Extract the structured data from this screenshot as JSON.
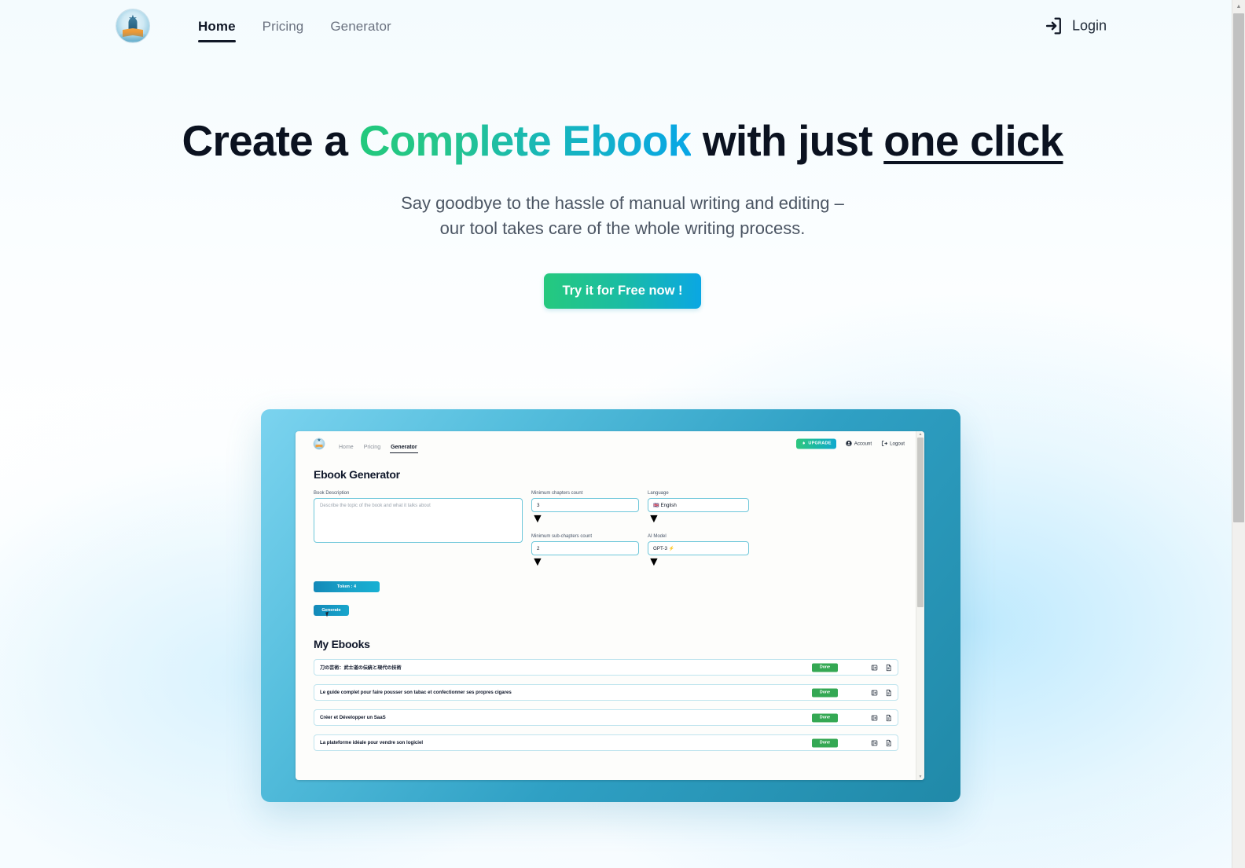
{
  "nav": {
    "logo_icon": "ebook-star-logo",
    "links": [
      {
        "label": "Home",
        "active": true
      },
      {
        "label": "Pricing",
        "active": false
      },
      {
        "label": "Generator",
        "active": false
      }
    ],
    "login": {
      "label": "Login",
      "icon": "sign-in-icon"
    }
  },
  "hero": {
    "headline_part1": "Create a ",
    "headline_highlight": "Complete Ebook",
    "headline_part2": " with just ",
    "headline_underlined": "one click",
    "subtitle_line1": "Say goodbye to the hassle of manual writing and editing –",
    "subtitle_line2": "our tool takes care of the whole writing process.",
    "cta_label": "Try it for Free now !"
  },
  "colors": {
    "gradient_start": "#22c97c",
    "gradient_end": "#08a6e6",
    "frame_light": "#7bd3ef",
    "frame_dark": "#2089a8",
    "status_done": "#34a853",
    "token_blue": "#1389b8"
  },
  "showcase": {
    "app_header": {
      "logo_icon": "ebook-star-logo",
      "links": [
        {
          "label": "Home",
          "active": false
        },
        {
          "label": "Pricing",
          "active": false
        },
        {
          "label": "Generator",
          "active": true
        }
      ],
      "upgrade_label": "UPGRADE",
      "upgrade_icon": "rocket-icon",
      "account_label": "Account",
      "account_icon": "user-circle-icon",
      "logout_label": "Logout",
      "logout_icon": "sign-out-icon"
    },
    "generator": {
      "title": "Ebook Generator",
      "book_description_label": "Book Description",
      "book_description_placeholder": "Describe the topic of the book and what it talks about",
      "book_description_value": "",
      "min_chapters_label": "Minimum chapters count",
      "min_chapters_value": "3",
      "min_subchapters_label": "Minimum sub-chapters count",
      "min_subchapters_value": "2",
      "language_label": "Language",
      "language_value": "English",
      "language_flag": "🇬🇧",
      "ai_model_label": "AI Model",
      "ai_model_value": "GPT-3",
      "ai_model_icon": "⚡",
      "token_badge": "Token : 4",
      "generate_label": "Generate"
    },
    "my_ebooks": {
      "title": "My Ebooks",
      "status_label": "Done",
      "icons": [
        {
          "name": "download-epub-icon"
        },
        {
          "name": "download-pdf-icon"
        }
      ],
      "items": [
        {
          "title": "刀の芸術：武士道の伝統と現代の技術",
          "status": "Done"
        },
        {
          "title": "Le guide complet pour faire pousser son tabac et confectionner ses propres cigares",
          "status": "Done"
        },
        {
          "title": "Créer et Développer un SaaS",
          "status": "Done"
        },
        {
          "title": "La plateforme idéale pour vendre son logiciel",
          "status": "Done"
        }
      ]
    }
  }
}
